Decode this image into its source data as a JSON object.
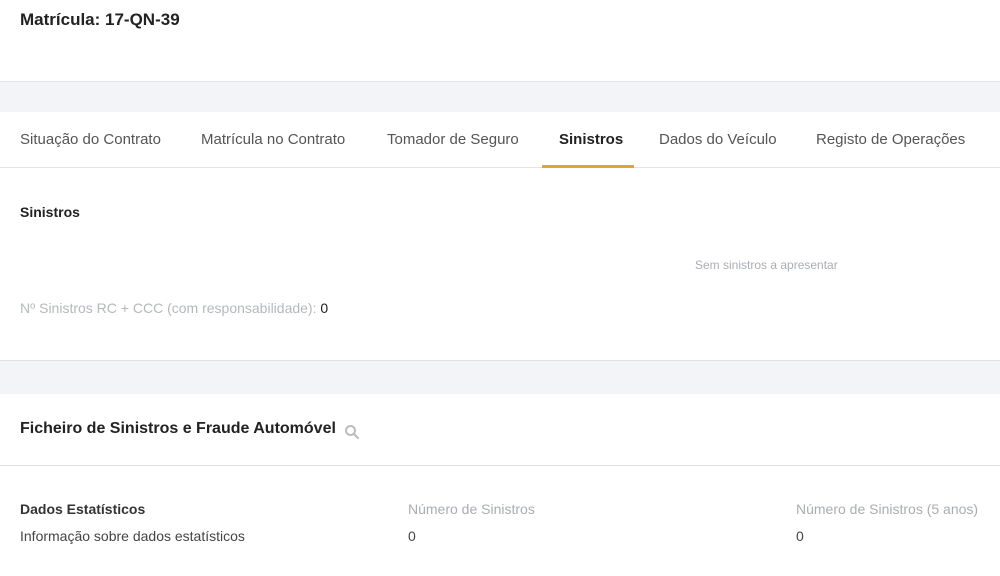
{
  "header": {
    "title": "Matrícula: 17-QN-39"
  },
  "tabs": [
    {
      "label": "Situação do Contrato",
      "active": false
    },
    {
      "label": "Matrícula no Contrato",
      "active": false
    },
    {
      "label": "Tomador de Seguro",
      "active": false
    },
    {
      "label": "Sinistros",
      "active": true
    },
    {
      "label": "Dados do Veículo",
      "active": false
    },
    {
      "label": "Registo de Operações",
      "active": false
    }
  ],
  "accent_color": "#e8a13a",
  "sinistros": {
    "title": "Sinistros",
    "empty_message": "Sem sinistros a apresentar",
    "count_label": "Nº Sinistros RC + CCC (com responsabilidade):",
    "count_value": "0"
  },
  "ficheiro": {
    "title": "Ficheiro de Sinistros e Fraude Automóvel",
    "search_icon": "search-icon",
    "stats": {
      "heading": "Dados Estatísticos",
      "description": "Informação sobre dados estatísticos",
      "col1_header": "Número de Sinistros",
      "col1_value": "0",
      "col2_header": "Número de Sinistros (5 anos)",
      "col2_value": "0"
    }
  }
}
